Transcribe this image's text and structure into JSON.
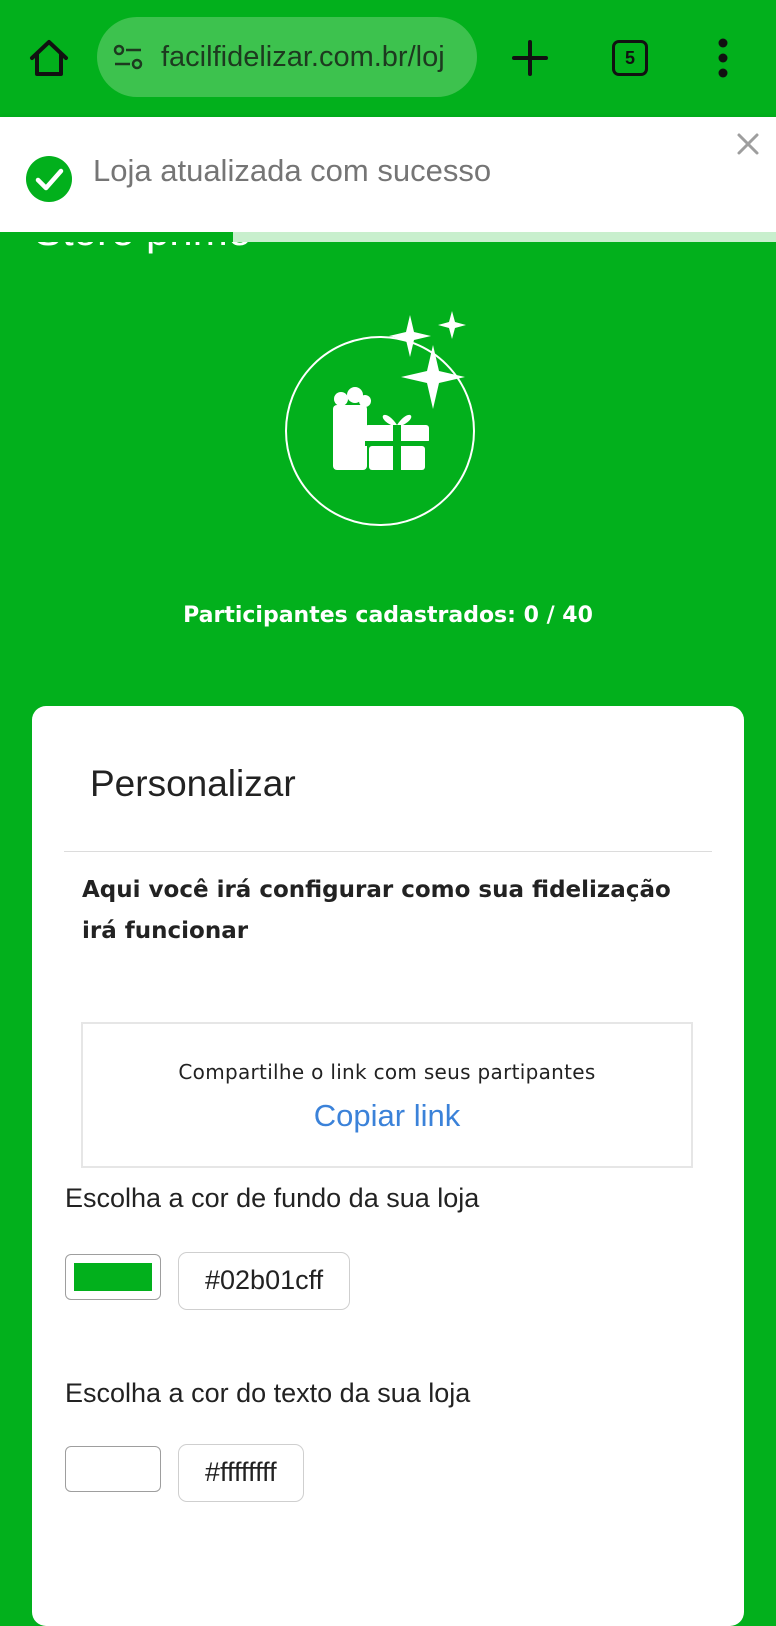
{
  "browser": {
    "url": "facilfidelizar.com.br/loj",
    "tab_count": "5",
    "home_icon": "home-icon",
    "site_icon": "site-settings-icon",
    "new_tab_icon": "plus-icon",
    "menu_icon": "more-vert-icon"
  },
  "toast": {
    "message": "Loja atualizada com sucesso",
    "icon": "check-circle-icon",
    "close_icon": "close-icon",
    "progress": 0.3
  },
  "store": {
    "title": "Store prime",
    "participants_label": "Participantes cadastrados: 0 / 40"
  },
  "card": {
    "title": "Personalizar",
    "description": "Aqui você irá configurar como sua fidelização irá funcionar",
    "share_label": "Compartilhe o link com seus partipantes",
    "copy_link": "Copiar link",
    "bg_color_label": "Escolha a cor de fundo da sua loja",
    "bg_color_value": "#02b01cff",
    "text_color_label": "Escolha a cor do texto da sua loja",
    "text_color_value": "#ffffffff"
  },
  "colors": {
    "brand_green": "#02b01c",
    "link_blue": "#3b82d9",
    "text_white": "#ffffff"
  }
}
